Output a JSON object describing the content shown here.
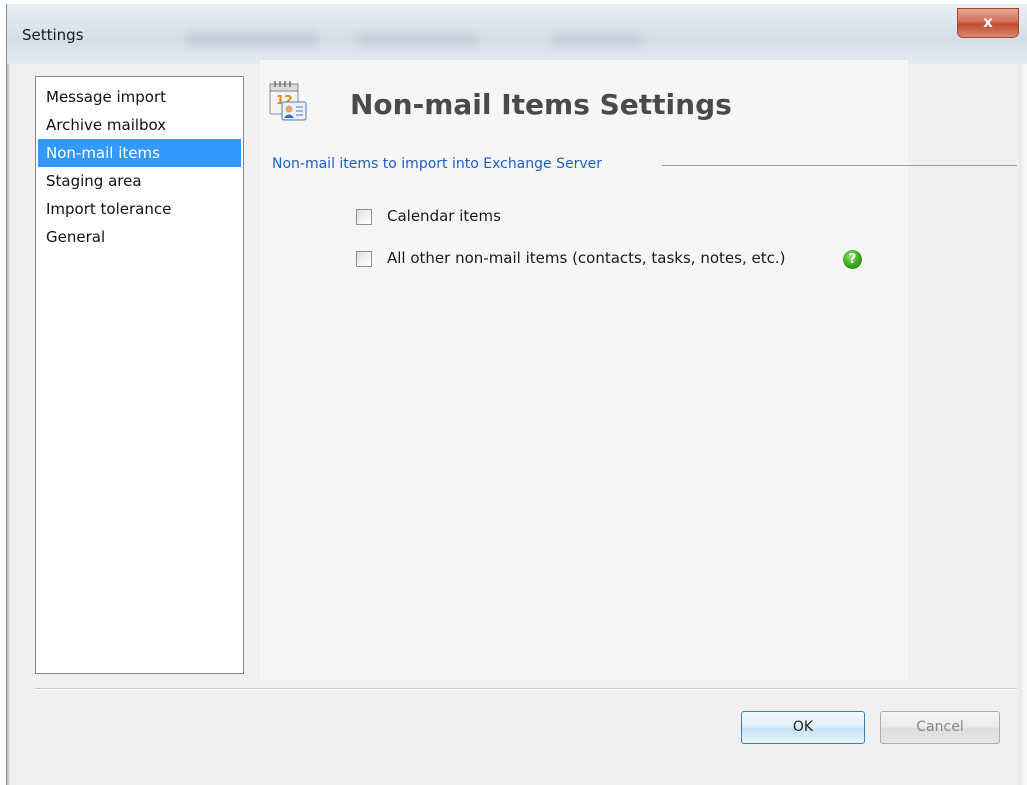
{
  "window": {
    "title": "Settings",
    "close_glyph": "x"
  },
  "sidebar": {
    "items": [
      {
        "label": "Message import",
        "selected": false
      },
      {
        "label": "Archive mailbox",
        "selected": false
      },
      {
        "label": "Non-mail items",
        "selected": true
      },
      {
        "label": "Staging area",
        "selected": false
      },
      {
        "label": "Import tolerance",
        "selected": false
      },
      {
        "label": "General",
        "selected": false
      }
    ]
  },
  "header": {
    "icon": "calendar-contact-icon",
    "title": "Non-mail Items Settings"
  },
  "group": {
    "label": "Non-mail items to import into Exchange Server"
  },
  "options": {
    "calendar_label": "Calendar items",
    "calendar_checked": false,
    "other_label": "All other non-mail items (contacts, tasks, notes, etc.)",
    "other_checked": false,
    "help_glyph": "?"
  },
  "buttons": {
    "ok_label": "OK",
    "cancel_label": "Cancel"
  },
  "colors": {
    "selection": "#3399ff",
    "group_label": "#1e5ec8",
    "help_icon": "#3aa51c",
    "close_button": "#c24b2e"
  }
}
